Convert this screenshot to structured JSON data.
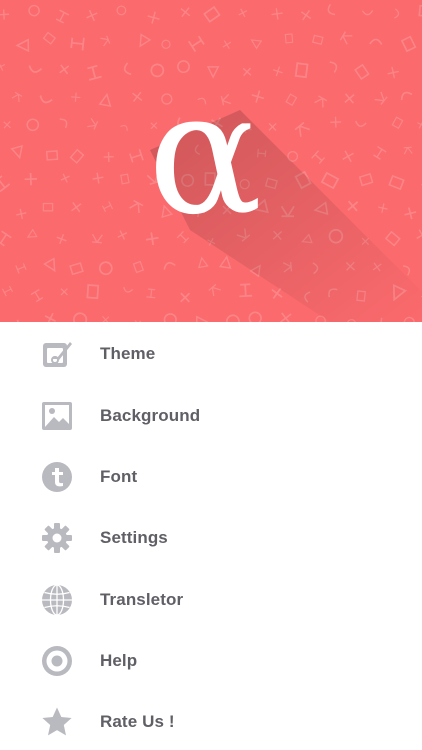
{
  "header": {
    "logo_glyph": "α",
    "background_color": "#fb6a6d"
  },
  "menu": {
    "items": [
      {
        "label": "Theme",
        "icon": "theme-icon"
      },
      {
        "label": "Background",
        "icon": "image-icon"
      },
      {
        "label": "Font",
        "icon": "font-icon"
      },
      {
        "label": "Settings",
        "icon": "gear-icon"
      },
      {
        "label": "Transletor",
        "icon": "globe-icon"
      },
      {
        "label": "Help",
        "icon": "help-icon"
      },
      {
        "label": "Rate Us !",
        "icon": "star-icon"
      }
    ],
    "icon_color": "#b9b9c0",
    "label_color": "#5f5f66"
  }
}
